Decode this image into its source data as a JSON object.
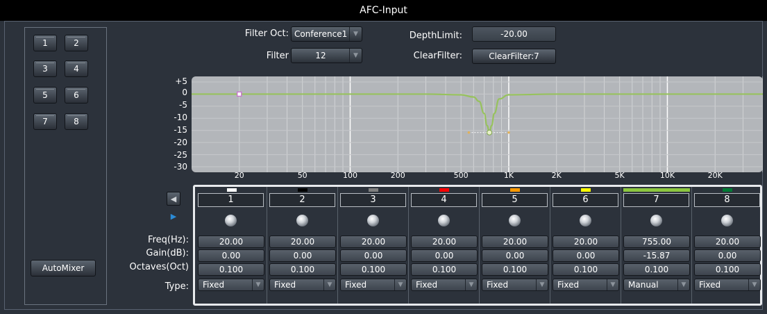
{
  "window": {
    "title": "AFC-Input"
  },
  "channel_buttons": [
    "1",
    "2",
    "3",
    "4",
    "5",
    "6",
    "7",
    "8"
  ],
  "automixer_label": "AutoMixer",
  "controls": {
    "filter_oct_label": "Filter Oct:",
    "filter_oct_value": "Conference1",
    "filter_label": "Filter",
    "filter_value": "12",
    "depth_limit_label": "DepthLimit:",
    "depth_limit_value": "-20.00",
    "clear_filter_label": "ClearFilter:",
    "clear_filter_button": "ClearFilter:7"
  },
  "colors": {
    "curve": "#97c25d",
    "graph_bg": "#b3b6ba",
    "selected_tab": "#8cc63f"
  },
  "icons": {
    "dropdown": "triangle-down-icon",
    "prev": "arrow-left-icon",
    "next": "arrow-right-icon",
    "knob": "knob-icon"
  },
  "chart_data": {
    "type": "line",
    "title": "",
    "xlabel": "",
    "ylabel": "",
    "x_scale": "log",
    "xlim": [
      10,
      40000
    ],
    "ylim": [
      -30,
      5
    ],
    "y_ticks": [
      "+5",
      "0",
      "-5",
      "-10",
      "-15",
      "-20",
      "-25",
      "-30"
    ],
    "x_ticks": [
      {
        "label": "20",
        "value": 20
      },
      {
        "label": "50",
        "value": 50
      },
      {
        "label": "100",
        "value": 100
      },
      {
        "label": "200",
        "value": 200
      },
      {
        "label": "500",
        "value": 500
      },
      {
        "label": "1K",
        "value": 1000
      },
      {
        "label": "2K",
        "value": 2000
      },
      {
        "label": "5K",
        "value": 5000
      },
      {
        "label": "10K",
        "value": 10000
      },
      {
        "label": "20K",
        "value": 20000
      }
    ],
    "grid": true,
    "series": [
      {
        "x": [
          10,
          20,
          100,
          300,
          500,
          600,
          650,
          700,
          730,
          755,
          780,
          810,
          870,
          1000,
          2000,
          5000,
          20000,
          40000
        ],
        "y": [
          0,
          0,
          0,
          0,
          -0.3,
          -1.2,
          -3.0,
          -8.0,
          -13.0,
          -15.87,
          -13.0,
          -8.0,
          -2.0,
          -0.3,
          0,
          0,
          0,
          0
        ]
      }
    ],
    "markers": [
      {
        "x": 20,
        "y": 0,
        "color": "#c86fcf"
      },
      {
        "x": 755,
        "y": -15.87,
        "color": "#e8f0c9"
      }
    ],
    "bandwidth": {
      "x_start": 560,
      "x_end": 1000,
      "y": -15.87
    }
  },
  "filter_table": {
    "row_labels": [
      "Freq(Hz):",
      "Gain(dB):",
      "Octaves(Oct)",
      "Type:"
    ],
    "selected_index": 6,
    "filters": [
      {
        "num": "1",
        "color": "#ffffff",
        "freq": "20.00",
        "gain": "0.00",
        "oct": "0.100",
        "type": "Fixed"
      },
      {
        "num": "2",
        "color": "#000000",
        "freq": "20.00",
        "gain": "0.00",
        "oct": "0.100",
        "type": "Fixed"
      },
      {
        "num": "3",
        "color": "#7f7f7f",
        "freq": "20.00",
        "gain": "0.00",
        "oct": "0.100",
        "type": "Fixed"
      },
      {
        "num": "4",
        "color": "#ff0000",
        "freq": "20.00",
        "gain": "0.00",
        "oct": "0.100",
        "type": "Fixed"
      },
      {
        "num": "5",
        "color": "#ff9900",
        "freq": "20.00",
        "gain": "0.00",
        "oct": "0.100",
        "type": "Fixed"
      },
      {
        "num": "6",
        "color": "#ffff00",
        "freq": "20.00",
        "gain": "0.00",
        "oct": "0.100",
        "type": "Fixed"
      },
      {
        "num": "7",
        "color": "#8cc63f",
        "freq": "755.00",
        "gain": "-15.87",
        "oct": "0.100",
        "type": "Manual"
      },
      {
        "num": "8",
        "color": "#007a33",
        "freq": "20.00",
        "gain": "0.00",
        "oct": "0.100",
        "type": "Fixed"
      }
    ]
  }
}
